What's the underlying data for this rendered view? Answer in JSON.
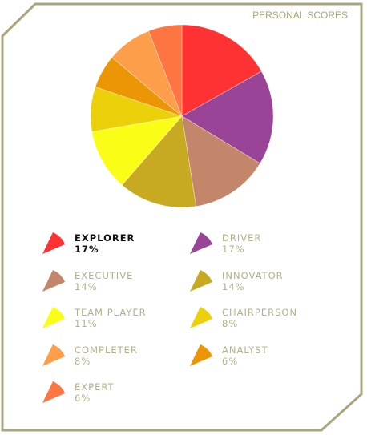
{
  "panel": {
    "title": "PERSONAL SCORES",
    "border_color": "#a9a57c",
    "active_item": "EXPLORER"
  },
  "chart_data": {
    "type": "pie",
    "title": "PERSONAL SCORES",
    "unit": "%",
    "slices": [
      {
        "label": "EXPLORER",
        "value": 17,
        "pct": "17%",
        "color": "#fe3233"
      },
      {
        "label": "DRIVER",
        "value": 17,
        "pct": "17%",
        "color": "#9a4497"
      },
      {
        "label": "EXECUTIVE",
        "value": 14,
        "pct": "14%",
        "color": "#c3866a"
      },
      {
        "label": "INNOVATOR",
        "value": 14,
        "pct": "14%",
        "color": "#c8aa22"
      },
      {
        "label": "TEAM PLAYER",
        "value": 11,
        "pct": "11%",
        "color": "#fafe16"
      },
      {
        "label": "CHAIRPERSON",
        "value": 8,
        "pct": "8%",
        "color": "#ecd00a"
      },
      {
        "label": "ANALYST",
        "value": 6,
        "pct": "6%",
        "color": "#ec9605"
      },
      {
        "label": "COMPLETER",
        "value": 8,
        "pct": "8%",
        "color": "#fd9e4a"
      },
      {
        "label": "EXPERT",
        "value": 6,
        "pct": "6%",
        "color": "#fe7542"
      }
    ],
    "legend_order": [
      "EXPLORER",
      "DRIVER",
      "EXECUTIVE",
      "INNOVATOR",
      "TEAM PLAYER",
      "CHAIRPERSON",
      "COMPLETER",
      "ANALYST",
      "EXPERT"
    ]
  }
}
